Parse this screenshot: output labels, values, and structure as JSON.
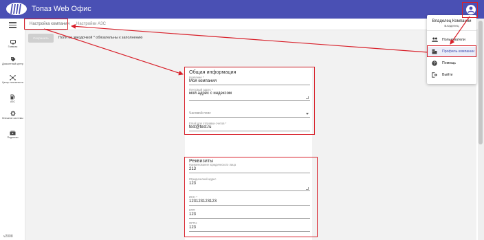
{
  "app": {
    "title": "Топаз Web Офис",
    "logo_icon": "topaz-logo-icon",
    "user_icon": "account-circle-icon",
    "header_color": "#4a50b4"
  },
  "sidebar": {
    "menu_icon": "hamburger-menu-icon",
    "items": [
      {
        "label": "Главная",
        "icon": "dashboard-icon"
      },
      {
        "label": "Дисконтный центр",
        "icon": "discount-tag-icon"
      },
      {
        "label": "Центр лояльности",
        "icon": "loyalty-network-icon"
      },
      {
        "label": "АЗС",
        "icon": "fuel-station-icon"
      },
      {
        "label": "Внешние системы",
        "icon": "settings-gear-icon"
      },
      {
        "label": "Подписки",
        "icon": "subscriptions-icon"
      }
    ],
    "version": "v2008"
  },
  "tabs": [
    {
      "label": "Настройка компании",
      "active": true
    },
    {
      "label": "Настройки АЗС",
      "active": false
    }
  ],
  "actions": {
    "save_label": "Сохранить",
    "required_note": "Поля со звездочкой * обязательны к заполнению"
  },
  "general_info": {
    "title": "Общая информация",
    "name_label": "Название *",
    "name_value": "Моя компания",
    "postal_label": "Почтовый адрес *",
    "postal_value": "мой адрес с индексом",
    "timezone_placeholder": "Часовой пояс",
    "email_label": "Email для отправки счетов *",
    "email_value": "test@test.ru"
  },
  "requisites": {
    "title": "Реквизиты",
    "legal_name_label": "Наименование юридического лица",
    "legal_name_value": "213",
    "legal_address_label": "Юридический адрес",
    "legal_address_value": "123",
    "inn_label": "ИНН *",
    "inn_value": "123123123123",
    "kpp_label": "КПП",
    "kpp_value": "123",
    "ogrn_label": "ОГРН",
    "ogrn_value": "123"
  },
  "user_menu": {
    "owner_name": "Владелец Компании",
    "owner_role": "Владелец",
    "items": [
      {
        "label": "Пользователи",
        "icon": "people-icon",
        "selected": false
      },
      {
        "label": "Профиль компании",
        "icon": "company-building-icon",
        "selected": true
      },
      {
        "label": "Помощь",
        "icon": "help-circle-icon",
        "selected": false
      },
      {
        "label": "Выйти",
        "icon": "logout-icon",
        "selected": false
      }
    ]
  },
  "colors": {
    "highlight": "#d8202a",
    "accent": "#4a50b4",
    "selected_text": "#3d4bb0"
  }
}
